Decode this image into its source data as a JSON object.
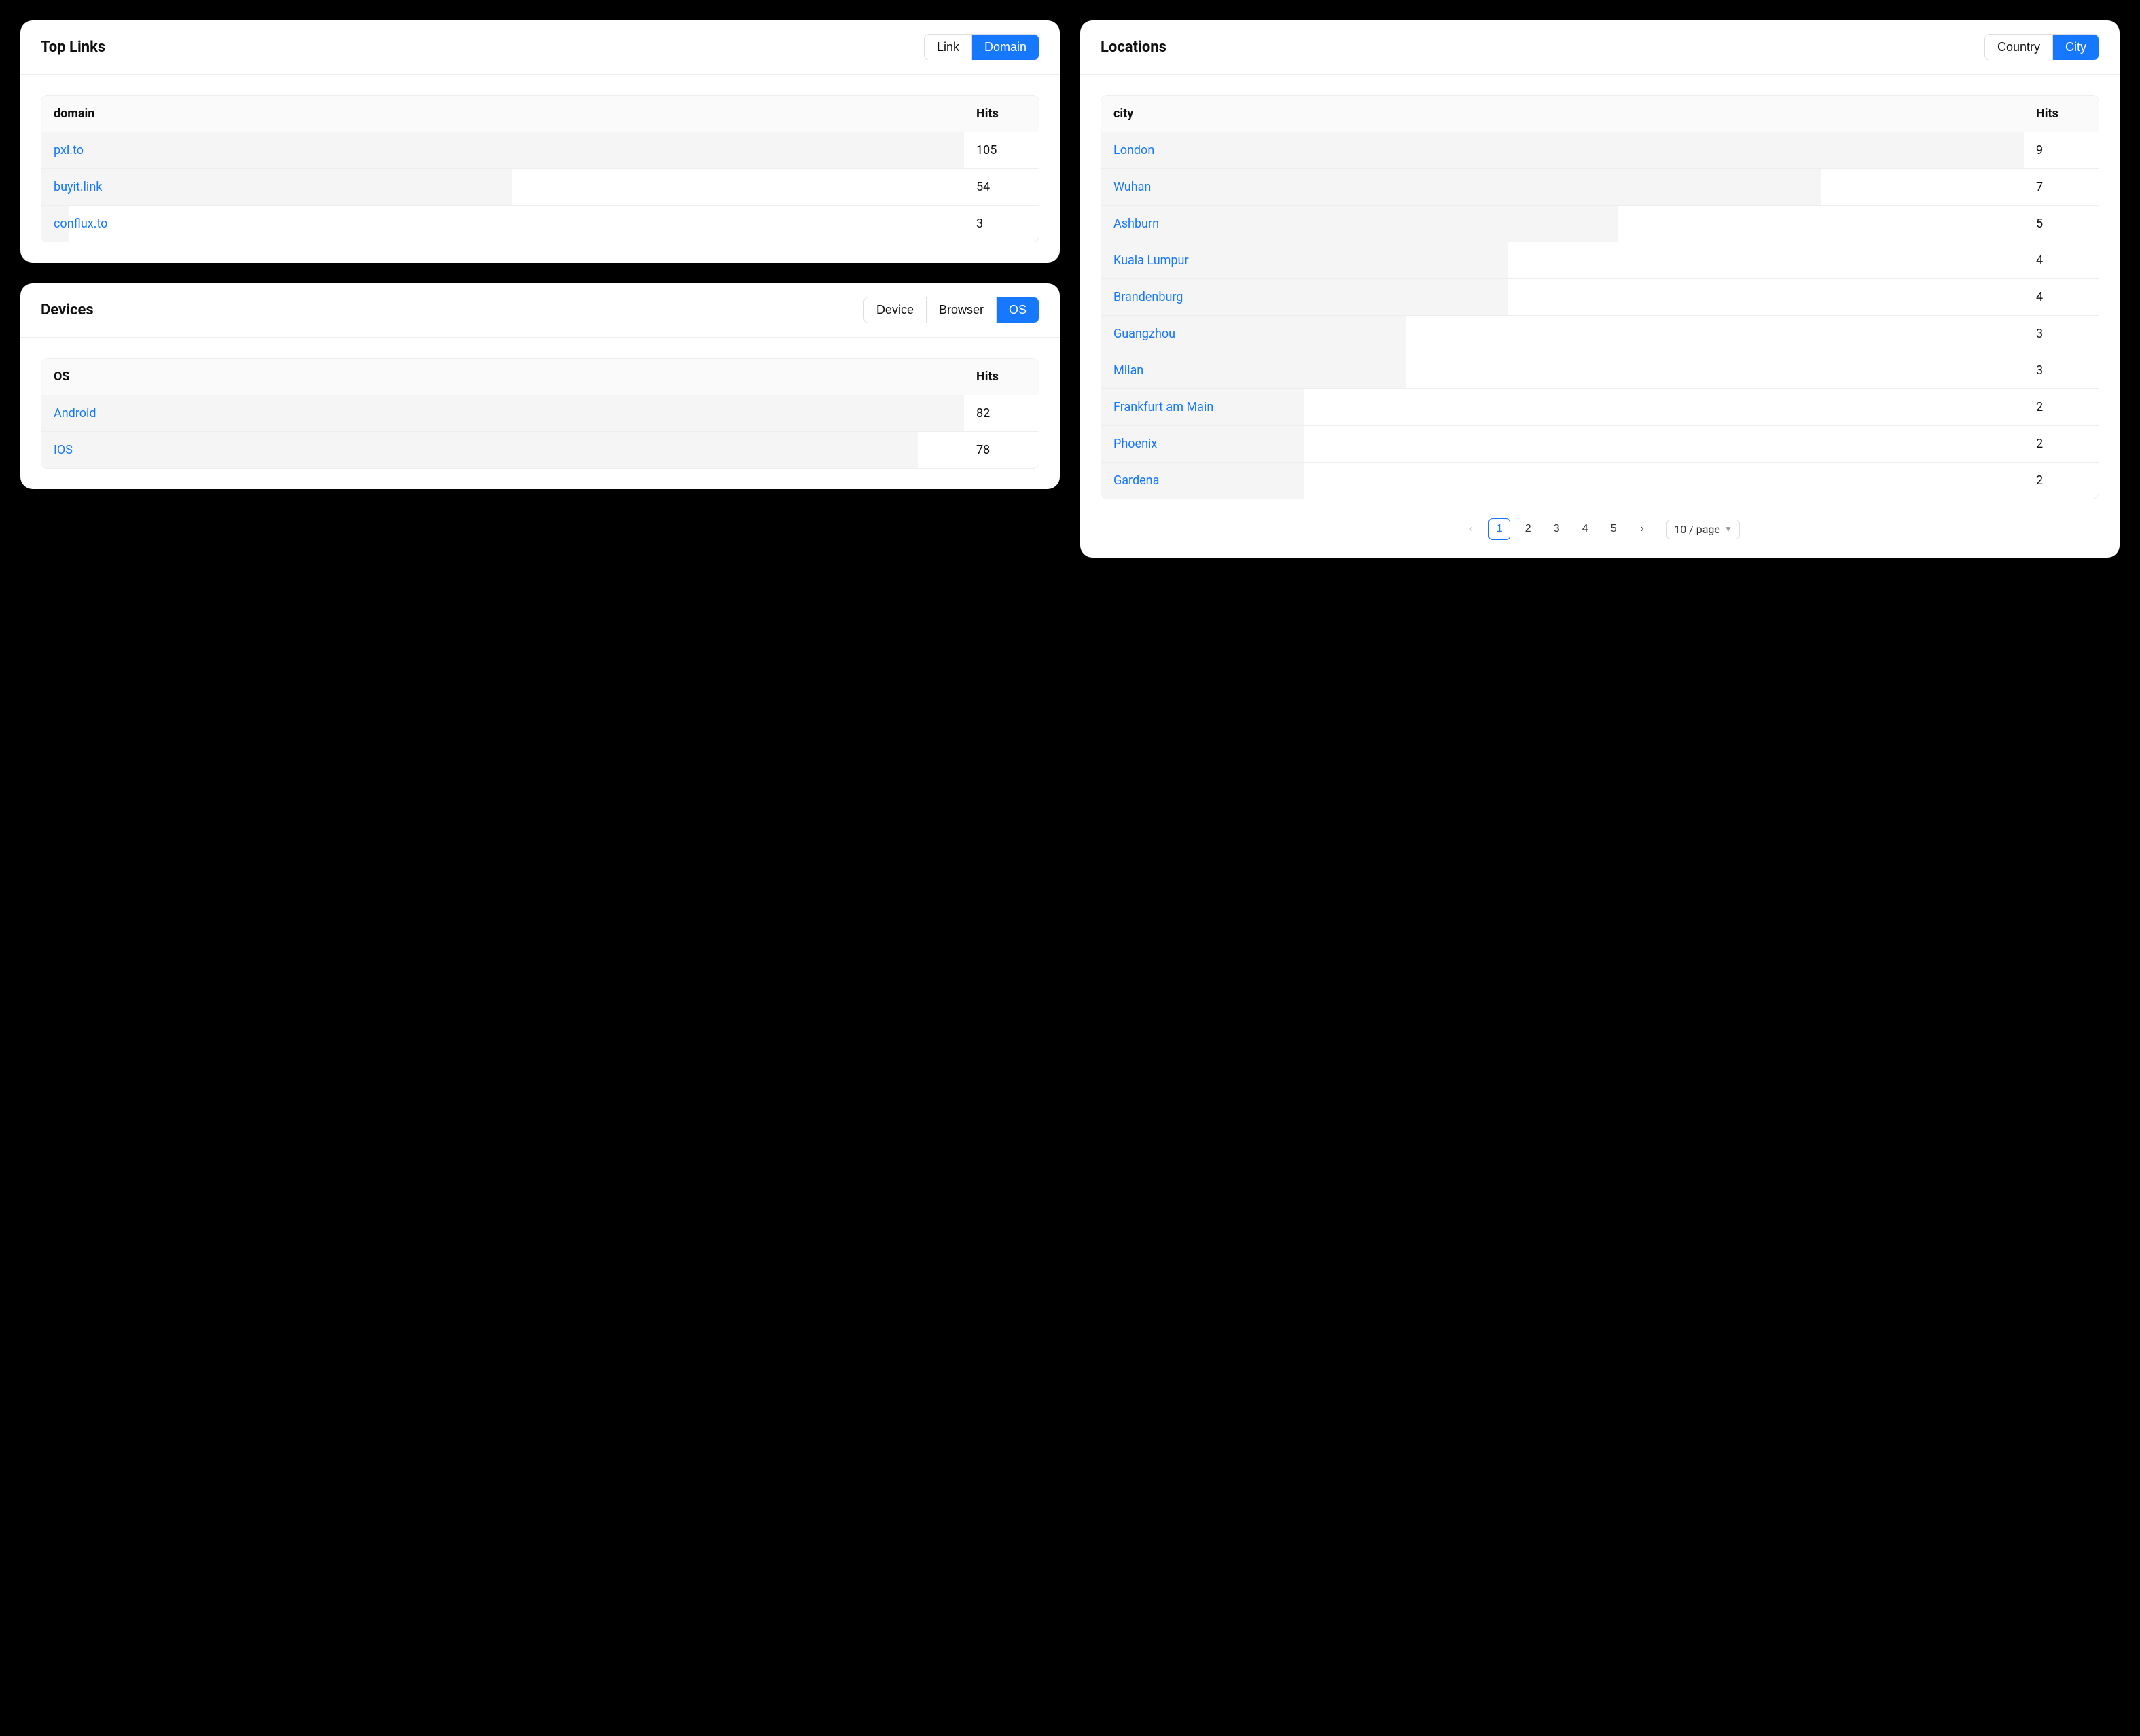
{
  "topLinks": {
    "title": "Top Links",
    "tabs": {
      "link": "Link",
      "domain": "Domain"
    },
    "activeTab": "domain",
    "columns": {
      "name": "domain",
      "hits": "Hits"
    },
    "rows": [
      {
        "name": "pxl.to",
        "hits": 105,
        "barPct": 100
      },
      {
        "name": "buyit.link",
        "hits": 54,
        "barPct": 51
      },
      {
        "name": "conflux.to",
        "hits": 3,
        "barPct": 3
      }
    ]
  },
  "devices": {
    "title": "Devices",
    "tabs": {
      "device": "Device",
      "browser": "Browser",
      "os": "OS"
    },
    "activeTab": "os",
    "columns": {
      "name": "OS",
      "hits": "Hits"
    },
    "rows": [
      {
        "name": "Android",
        "hits": 82,
        "barPct": 100
      },
      {
        "name": "IOS",
        "hits": 78,
        "barPct": 95
      }
    ]
  },
  "locations": {
    "title": "Locations",
    "tabs": {
      "country": "Country",
      "city": "City"
    },
    "activeTab": "city",
    "columns": {
      "name": "city",
      "hits": "Hits"
    },
    "rows": [
      {
        "name": "London",
        "hits": 9,
        "barPct": 100
      },
      {
        "name": "Wuhan",
        "hits": 7,
        "barPct": 78
      },
      {
        "name": "Ashburn",
        "hits": 5,
        "barPct": 56
      },
      {
        "name": "Kuala Lumpur",
        "hits": 4,
        "barPct": 44
      },
      {
        "name": "Brandenburg",
        "hits": 4,
        "barPct": 44
      },
      {
        "name": "Guangzhou",
        "hits": 3,
        "barPct": 33
      },
      {
        "name": "Milan",
        "hits": 3,
        "barPct": 33
      },
      {
        "name": "Frankfurt am Main",
        "hits": 2,
        "barPct": 22
      },
      {
        "name": "Phoenix",
        "hits": 2,
        "barPct": 22
      },
      {
        "name": "Gardena",
        "hits": 2,
        "barPct": 22
      }
    ],
    "pagination": {
      "pages": [
        1,
        2,
        3,
        4,
        5
      ],
      "current": 1,
      "pageSizeLabel": "10 / page"
    }
  }
}
